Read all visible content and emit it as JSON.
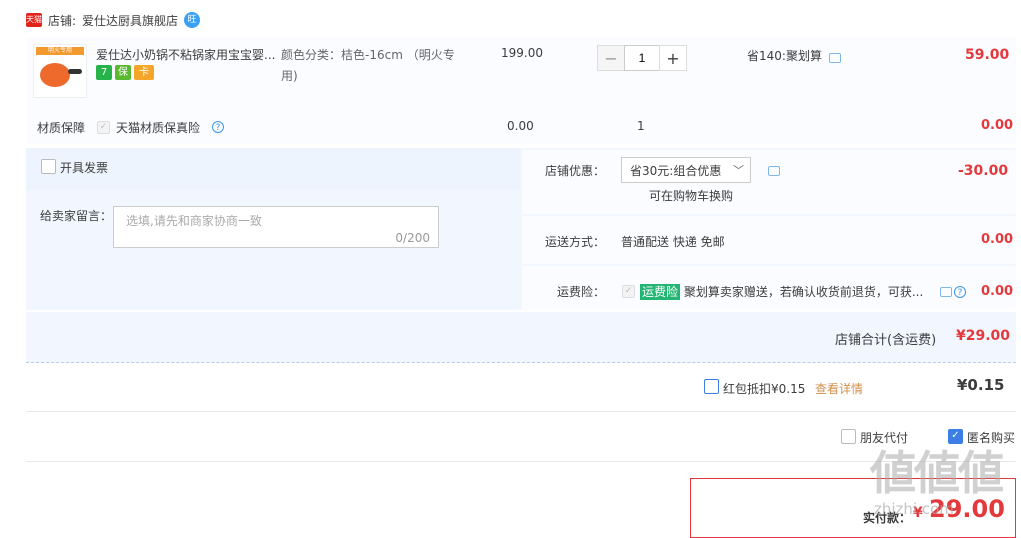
{
  "shop": {
    "badge": "天猫",
    "label": "店铺:",
    "name": "爱仕达厨具旗舰店",
    "ww": "旺"
  },
  "item": {
    "thumb_banner": "明火专用",
    "title": "爱仕达小奶锅不粘锅家用宝宝婴...",
    "spec_line1": "颜色分类：桔色-16cm （明火专",
    "spec_line2": "用)",
    "tags": [
      {
        "text": "7",
        "color": "#25b34a"
      },
      {
        "text": "保",
        "color": "#5bb931"
      },
      {
        "text": "卡",
        "color": "#f4a62a"
      }
    ],
    "price": "199.00",
    "qty_minus": "−",
    "qty": "1",
    "qty_plus": "+",
    "promo": "省140:聚划算",
    "subtotal": "59.00"
  },
  "material": {
    "label": "材质保障",
    "check": "✓",
    "name": "天猫材质保真险",
    "help": "?",
    "price": "0.00",
    "qty": "1",
    "subtotal": "0.00"
  },
  "invoice": {
    "label": "开具发票"
  },
  "message": {
    "label": "给卖家留言：",
    "placeholder": "选填,请先和商家协商一致",
    "counter": "0/200"
  },
  "discount": {
    "label": "店铺优惠：",
    "selected": "省30元:组合优惠",
    "chevron": "﹀",
    "note": "可在购物车换购",
    "amount": "-30.00"
  },
  "shipping": {
    "label": "运送方式：",
    "method": "普通配送 快递 免邮",
    "amount": "0.00"
  },
  "insurance": {
    "label": "运费险：",
    "check": "✓",
    "tag": "运费险",
    "desc": "聚划算卖家赠送，若确认收货前退货，可获...",
    "help": "?",
    "amount": "0.00"
  },
  "shop_total": {
    "label": "店铺合计(含运费)",
    "amount": "¥29.00"
  },
  "redpacket": {
    "label": "红包抵扣¥0.15",
    "link": "查看详情",
    "amount": "¥0.15"
  },
  "options": {
    "friend_pay": "朋友代付",
    "anonymous": "匿名购买",
    "check": "✓"
  },
  "pay": {
    "label": "实付款：",
    "currency": "¥",
    "amount": "29.00"
  },
  "watermark": {
    "main": "値値値",
    "sub": "zhizhi.com"
  }
}
